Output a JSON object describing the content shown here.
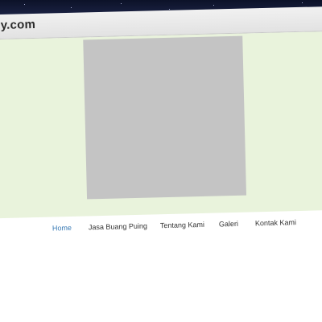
{
  "site": {
    "title": "y.com"
  },
  "hero": {
    "image_icon": "image-placeholder-icon"
  },
  "nav": {
    "items": [
      {
        "label": "Home",
        "active": true
      },
      {
        "label": "Jasa Buang Puing",
        "active": false
      },
      {
        "label": "Tentang Kami",
        "active": false
      },
      {
        "label": "Galeri",
        "active": false
      },
      {
        "label": "Kontak Kami",
        "active": false
      }
    ]
  },
  "colors": {
    "hero_bg": "#e9f3dc",
    "active_link": "#3a7bb5",
    "placeholder": "#c4c4c4"
  }
}
